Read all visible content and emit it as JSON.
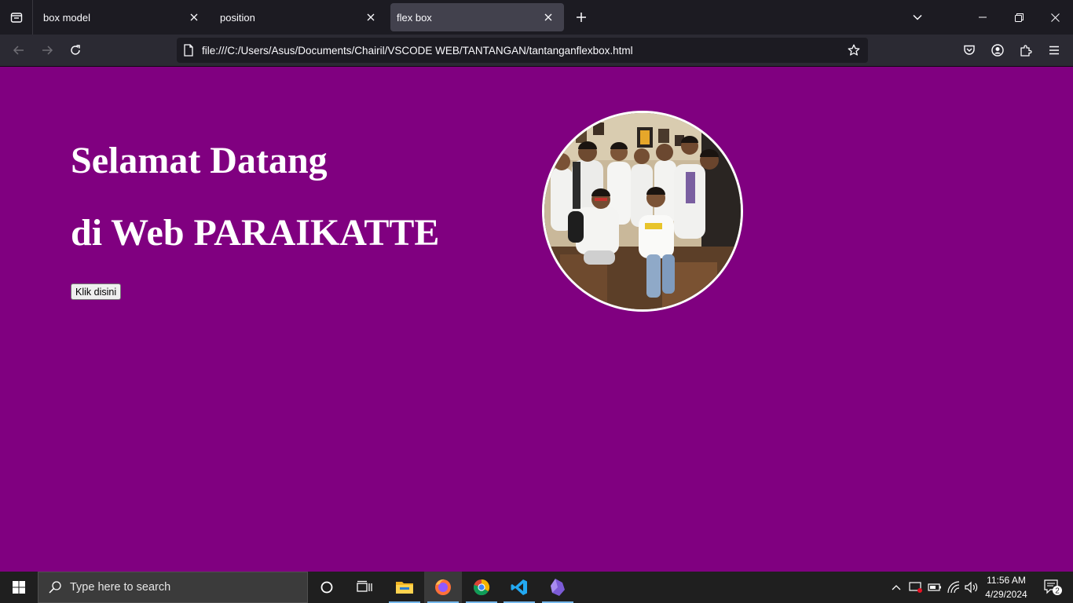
{
  "browser": {
    "tabs": [
      {
        "label": "box model",
        "active": false
      },
      {
        "label": "position",
        "active": false
      },
      {
        "label": "flex box",
        "active": true
      }
    ],
    "url": "file:///C:/Users/Asus/Documents/Chairil/VSCODE WEB/TANTANGAN/tantanganflexbox.html"
  },
  "page": {
    "background": "#800080",
    "heading_line1": "Selamat Datang",
    "heading_line2": "di Web PARAIKATTE",
    "button_label": "Klik disini"
  },
  "taskbar": {
    "search_placeholder": "Type here to search",
    "apps": [
      "file-explorer",
      "firefox",
      "chrome",
      "vscode",
      "obsidian"
    ],
    "time": "11:56 AM",
    "date": "4/29/2024",
    "notification_count": "2"
  }
}
